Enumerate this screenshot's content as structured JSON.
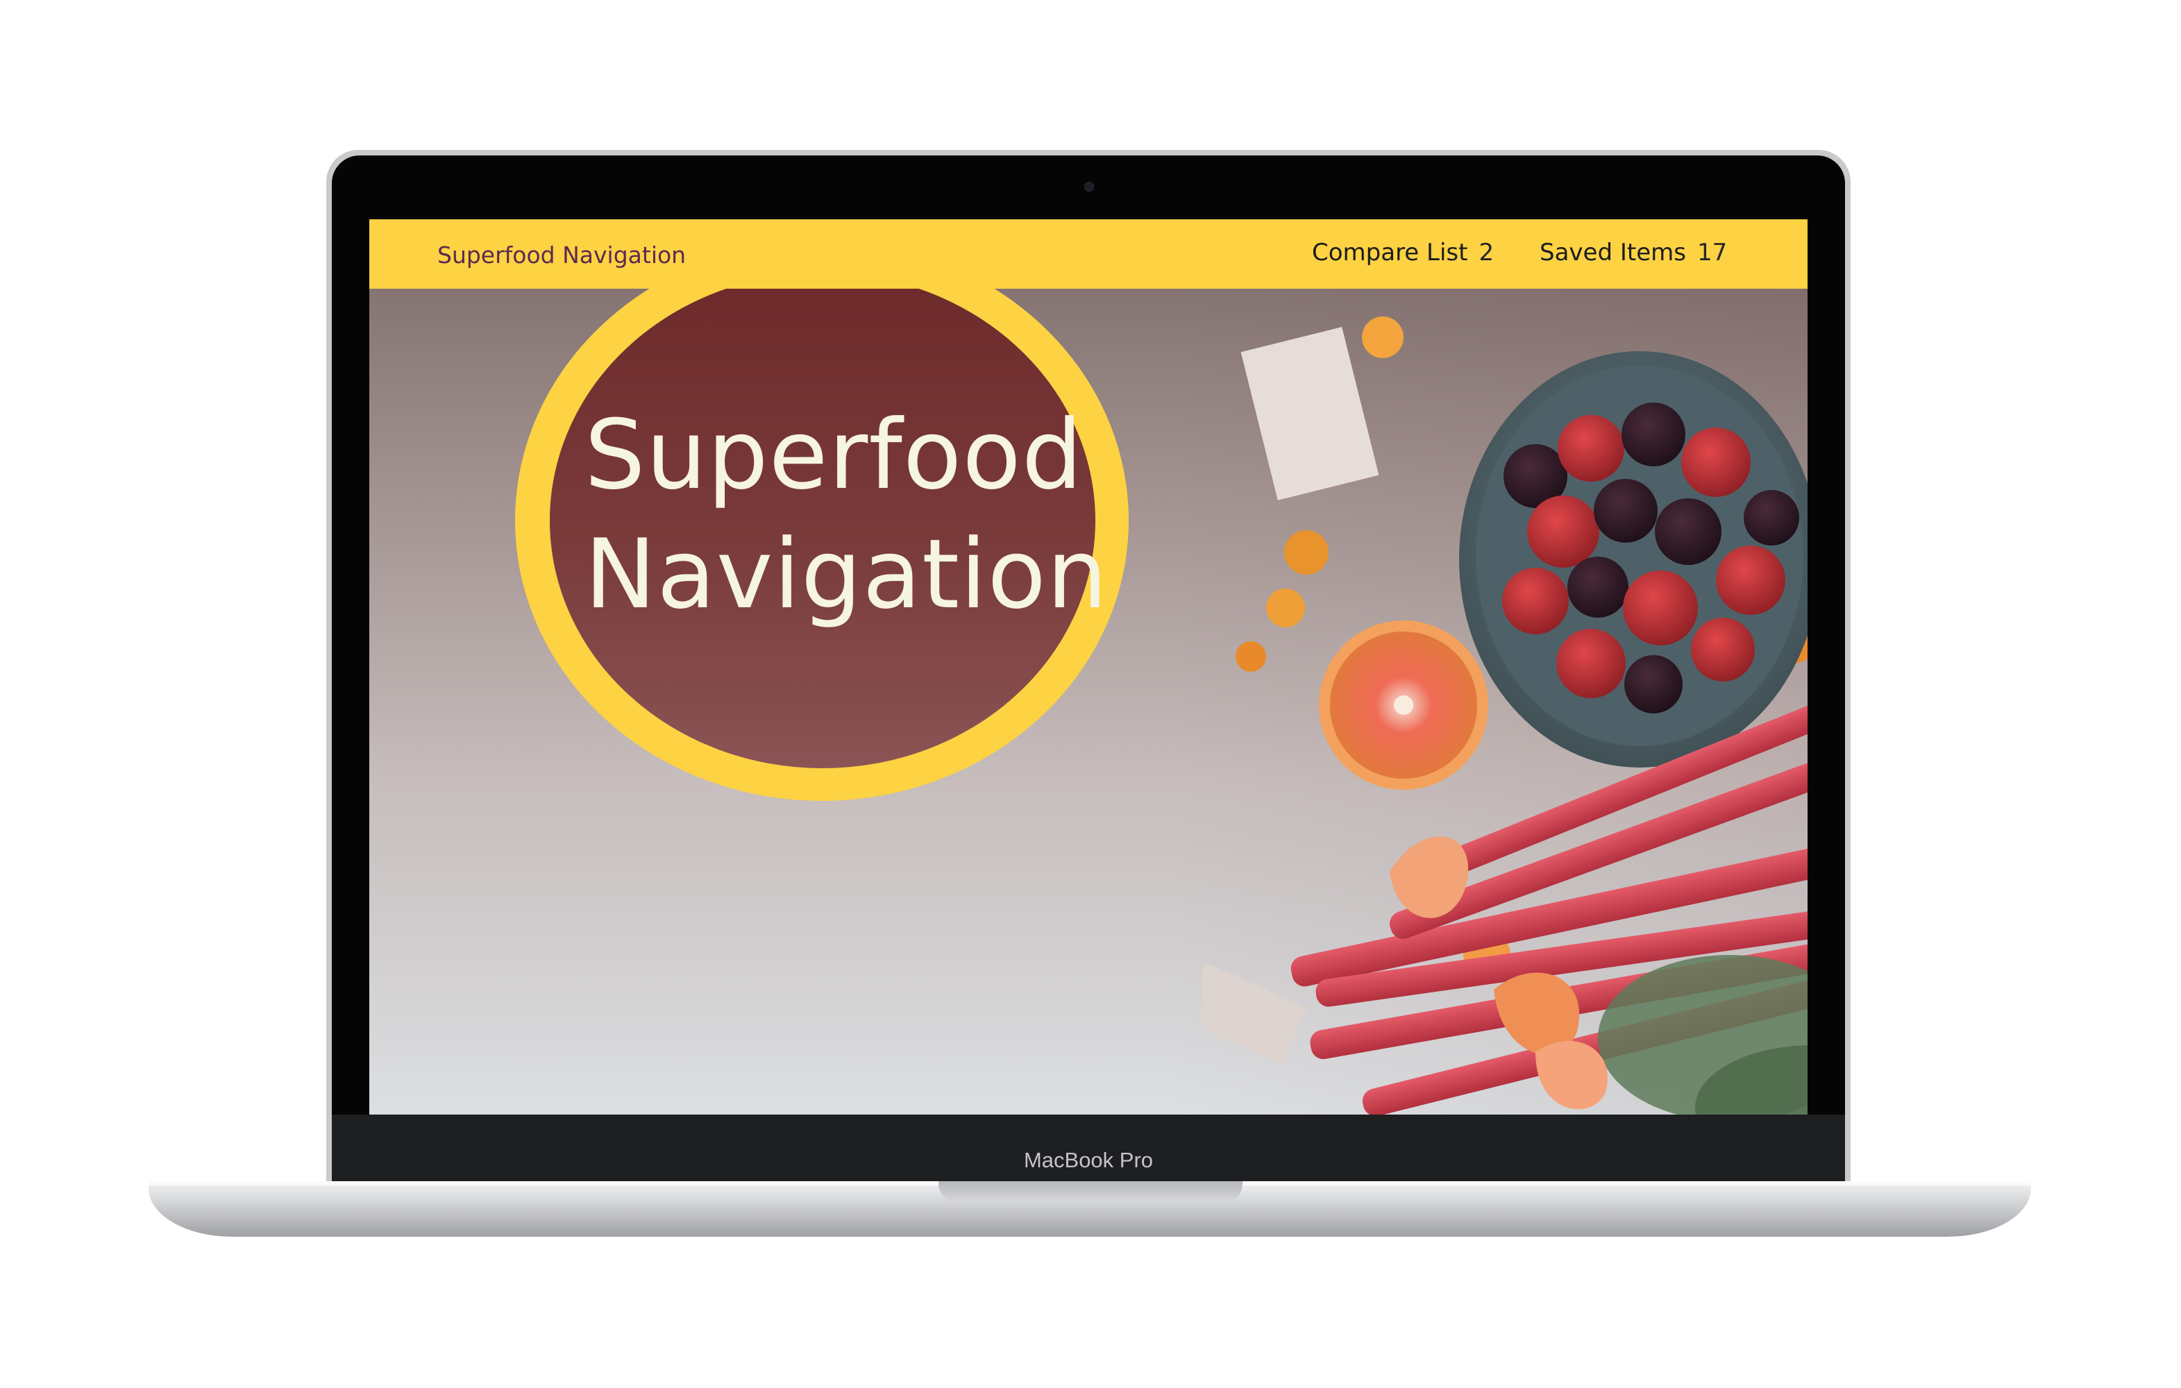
{
  "device": {
    "label": "MacBook Pro"
  },
  "site": {
    "nav": {
      "brand": "Superfood Navigation",
      "compare_label": "Compare List",
      "compare_count": "2",
      "saved_label": "Saved Items",
      "saved_count": "17"
    },
    "hero": {
      "title": "Superfood\nNavigation"
    }
  },
  "colors": {
    "navbar": "#fdd243",
    "brand_text": "#5c2a4f",
    "badge": "#7a3b3b",
    "hero_text": "#f6f4e2"
  },
  "icons": {
    "camera": "camera-dot",
    "food_photo": "fruit-rhubarb-photo"
  }
}
